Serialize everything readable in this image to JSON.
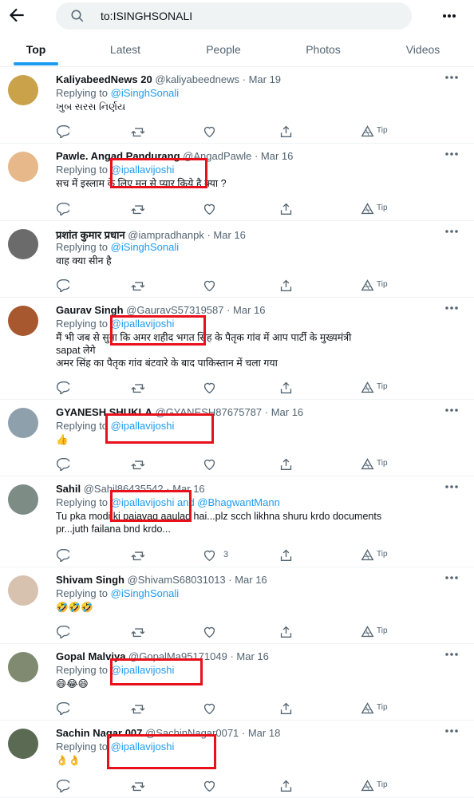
{
  "search": {
    "query": "to:ISINGHSONALI"
  },
  "tabs": [
    {
      "label": "Top"
    },
    {
      "label": "Latest"
    },
    {
      "label": "People"
    },
    {
      "label": "Photos"
    },
    {
      "label": "Videos"
    }
  ],
  "icons": {
    "back": "arrow-left-icon",
    "search": "search-icon",
    "more": "more-dots-icon",
    "reply": "reply-icon",
    "retweet": "retweet-icon",
    "like": "heart-icon",
    "share": "share-icon",
    "tip": "tip-icon"
  },
  "tweets": [
    {
      "name": "KaliyabeedNews 20",
      "meta": "@kaliyabeednews · Mar 19",
      "replying": "Replying to",
      "handle": "@iSinghSonali",
      "handle2": "",
      "lines": [
        "ખુબ સરસ નિર્ણય"
      ],
      "likes": "",
      "tip": "Tip"
    },
    {
      "name": "Pawle. Angad Pandurang",
      "meta": "@AngadPawle · Mar 16",
      "replying": "Replying to",
      "handle": "@ipallavijoshi",
      "handle2": "",
      "lines": [
        "सच में इस्लाम के लिए मन से प्यार किये है क्या ?"
      ],
      "likes": "",
      "tip": "Tip"
    },
    {
      "name": "प्रशांत कुमार प्रधान",
      "meta": "@iampradhanpk · Mar 16",
      "replying": "Replying to",
      "handle": "@iSinghSonali",
      "handle2": "",
      "lines": [
        "वाह क्या सीन है"
      ],
      "likes": "",
      "tip": "Tip"
    },
    {
      "name": "Gaurav Singh",
      "meta": "@GauravS57319587 · Mar 16",
      "replying": "Replying to",
      "handle": "@ipallavijoshi",
      "handle2": "",
      "lines": [
        "मैं भी जब से सुना कि अमर शहीद भगत सिंह के पैतृक गांव में आप पार्टी के मुख्यमंत्री",
        "sapat लेगे",
        "अमर सिंह का पैतृक गांव बंटवारे के बाद पाकिस्तान में चला गया"
      ],
      "likes": "",
      "tip": "Tip"
    },
    {
      "name": "GYANESH SHUKLA",
      "meta": "@GYANESH87675787 · Mar 16",
      "replying": "Replying to",
      "handle": "@ipallavijoshi",
      "handle2": "",
      "lines": [
        "👍"
      ],
      "likes": "",
      "tip": "Tip"
    },
    {
      "name": "Sahil",
      "meta": "@Sahil86435542 · Mar 16",
      "replying": "Replying to",
      "handle": "@ipallavijoshi",
      "handle2": "and @BhagwantMann",
      "lines": [
        "Tu pka modi ki pajavag aaulad hai...plz scch likhna shuru krdo documents",
        "pr...juth failana bnd krdo..."
      ],
      "likes": "3",
      "tip": "Tip"
    },
    {
      "name": "Shivam Singh",
      "meta": "@ShivamS68031013 · Mar 16",
      "replying": "Replying to",
      "handle": "@iSinghSonali",
      "handle2": "",
      "lines": [
        "🤣🤣🤣"
      ],
      "likes": "",
      "tip": "Tip"
    },
    {
      "name": "Gopal Malviya",
      "meta": "@GopalMa95171049 · Mar 16",
      "replying": "Replying to",
      "handle": "@ipallavijoshi",
      "handle2": "",
      "lines": [
        "😄😂😄"
      ],
      "likes": "",
      "tip": "Tip"
    },
    {
      "name": "Sachin Nagar 007",
      "meta": "@SachinNagar0071 · Mar 18",
      "replying": "Replying to",
      "handle": "@ipallavijoshi",
      "handle2": "",
      "lines": [
        "👌👌"
      ],
      "likes": "",
      "tip": "Tip"
    }
  ],
  "colors": {
    "accent": "#1d9bf0",
    "highlight": "#e8101a",
    "muted": "#536471"
  }
}
